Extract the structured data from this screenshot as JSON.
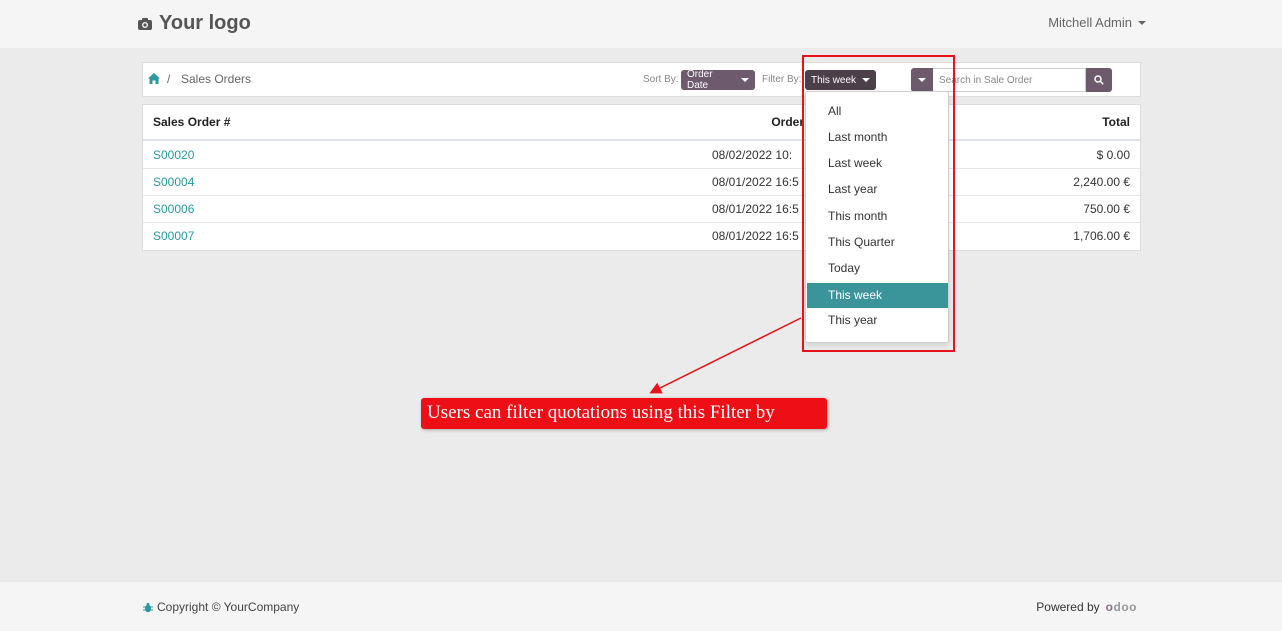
{
  "header": {
    "logo_text": "Your logo",
    "logo_icon": "camera-icon",
    "user_name": "Mitchell Admin"
  },
  "breadcrumb": {
    "home_icon": "home-icon",
    "separator": "/",
    "current": "Sales Orders"
  },
  "toolbar": {
    "sort_label": "Sort By:",
    "sort_value": "Order Date",
    "filter_label": "Filter By:",
    "filter_value": "This week",
    "search_placeholder": "Search in Sale Order",
    "search_icon": "search-icon"
  },
  "table": {
    "columns": [
      "Sales Order #",
      "Order",
      "Total"
    ],
    "rows": [
      {
        "number": "S00020",
        "date": "08/02/2022  10:",
        "total": "$ 0.00"
      },
      {
        "number": "S00004",
        "date": "08/01/2022  16:5",
        "total": "2,240.00 €"
      },
      {
        "number": "S00006",
        "date": "08/01/2022  16:5",
        "total": "750.00 €"
      },
      {
        "number": "S00007",
        "date": "08/01/2022  16:5",
        "total": "1,706.00 €"
      }
    ]
  },
  "filter_menu": {
    "items": [
      "All",
      "Last month",
      "Last week",
      "Last year",
      "This month",
      "This Quarter",
      "Today",
      "This week",
      "This year"
    ],
    "selected": "This week"
  },
  "annotation": {
    "callout_text": "Users can filter quotations using this Filter by",
    "highlight_color": "#e8131a"
  },
  "footer": {
    "copyright": "Copyright © YourCompany",
    "powered_by": "Powered by",
    "brand": "odoo"
  },
  "colors": {
    "primary": "#6e5a6d",
    "active_item": "#3a959a",
    "link": "#2c98a0"
  }
}
